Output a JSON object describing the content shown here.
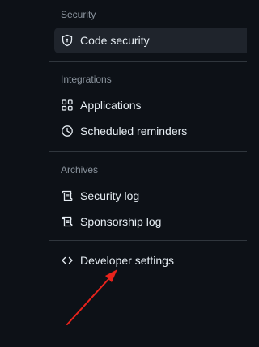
{
  "sections": {
    "security": {
      "heading": "Security",
      "items": [
        {
          "label": "Code security",
          "icon": "shield-icon",
          "selected": true
        }
      ]
    },
    "integrations": {
      "heading": "Integrations",
      "items": [
        {
          "label": "Applications",
          "icon": "apps-icon"
        },
        {
          "label": "Scheduled reminders",
          "icon": "clock-icon"
        }
      ]
    },
    "archives": {
      "heading": "Archives",
      "items": [
        {
          "label": "Security log",
          "icon": "log-icon"
        },
        {
          "label": "Sponsorship log",
          "icon": "log-icon"
        }
      ]
    },
    "developer": {
      "items": [
        {
          "label": "Developer settings",
          "icon": "code-icon"
        }
      ]
    }
  },
  "annotation": {
    "arrow_color": "#e8231c"
  },
  "colors": {
    "background": "#0d1117",
    "text": "#e6edf3",
    "muted": "#8b949e",
    "selected_bg": "#1f242c",
    "divider": "#30363d"
  }
}
